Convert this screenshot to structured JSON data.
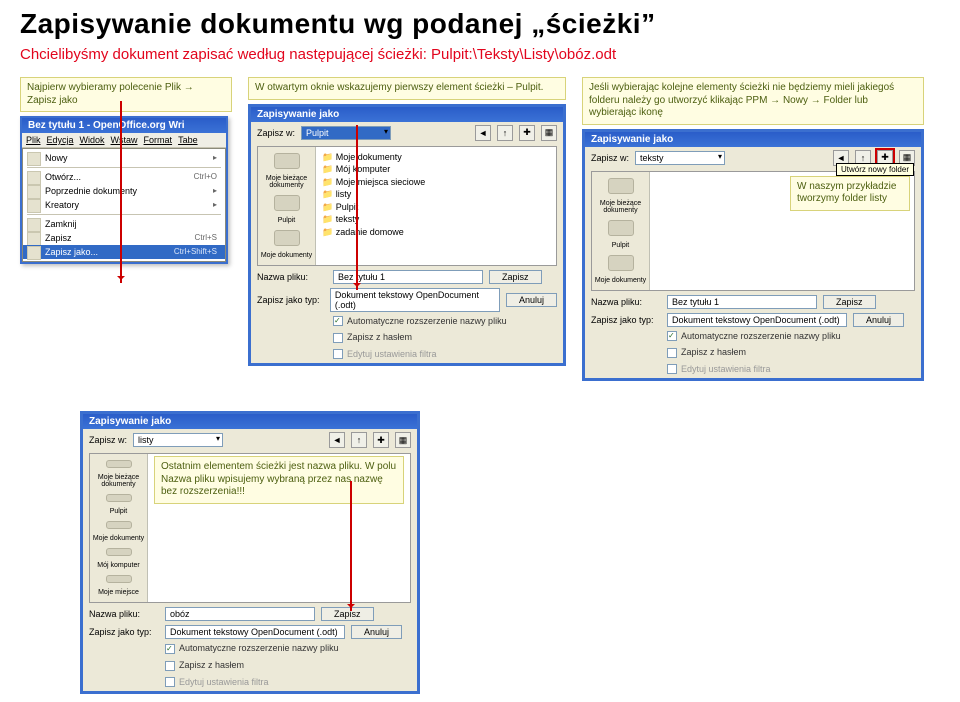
{
  "title": "Zapisywanie dokumentu wg podanej „ścieżki”",
  "subtitle": "Chcielibyśmy dokument zapisać według następującej ścieżki: Pulpit:\\Teksty\\Listy\\obóz.odt",
  "cap1": "Najpierw wybieramy polecenie Plik → Zapisz jako",
  "cap2": "W otwartym oknie wskazujemy pierwszy element ścieżki – Pulpit.",
  "cap3": "Jeśli wybierając kolejne elementy ścieżki nie będziemy mieli jakiegoś folderu należy go utworzyć klikając PPM → Nowy → Folder lub wybierając ikonę",
  "cap4": "W naszym przykładzie tworzymy folder listy",
  "cap5": "Ostatnim elementem ścieżki jest nazwa pliku. W polu Nazwa pliku wpisujemy wybraną przez nas nazwę bez rozszerzenia!!!",
  "writer": {
    "title": "Bez tytułu 1 - OpenOffice.org Wri",
    "menus": [
      "Plik",
      "Edycja",
      "Widok",
      "Wstaw",
      "Format",
      "Tabe"
    ],
    "items": [
      {
        "label": "Nowy",
        "sc": "",
        "arrow": "▸"
      },
      {
        "label": "Otwórz...",
        "sc": "Ctrl+O"
      },
      {
        "label": "Poprzednie dokumenty",
        "sc": "",
        "arrow": "▸"
      },
      {
        "label": "Kreatory",
        "sc": "",
        "arrow": "▸"
      },
      {
        "sep": true
      },
      {
        "label": "Zamknij",
        "sc": ""
      },
      {
        "label": "Zapisz",
        "sc": "Ctrl+S"
      },
      {
        "label": "Zapisz jako...",
        "sc": "Ctrl+Shift+S",
        "hi": true
      }
    ]
  },
  "dlg": {
    "title": "Zapisywanie jako",
    "saveInLabel": "Zapisz w:",
    "loc1": "Pulpit",
    "loc2": "teksty",
    "loc3": "listy",
    "folders1": [
      "Moje dokumenty",
      "Mój komputer",
      "Moje miejsca sieciowe",
      "listy",
      "Pulpit",
      "teksty",
      "zadanie domowe"
    ],
    "thumbs2": [
      "Moje bieżące dokumenty",
      "Pulpit",
      "Moje dokumenty",
      "Mój komputer"
    ],
    "thumbs3": [
      "Moje bieżące dokumenty",
      "Pulpit",
      "Moje dokumenty",
      "Mój komputer",
      "Moje miejsca"
    ],
    "side": [
      "Moje bieżące dokumenty",
      "Pulpit",
      "Moje dokumenty",
      "Mój komputer",
      "Moje miejsce"
    ],
    "newFolderTip": "Utwórz nowy folder",
    "fileLabel": "Nazwa pliku:",
    "typeLabel": "Zapisz jako typ:",
    "fileName1": "Bez tytułu 1",
    "fileName2": "obóz",
    "typeVal": "Dokument tekstowy OpenDocument (.odt)",
    "typeVal2": "Dokument tekstowy OpenDocument (.odt)",
    "saveBtn": "Zapisz",
    "cancelBtn": "Anuluj",
    "chkAuto": "Automatyczne rozszerzenie nazwy pliku",
    "chkPass": "Zapisz z hasłem",
    "chkFilter": "Edytuj ustawienia filtra"
  }
}
